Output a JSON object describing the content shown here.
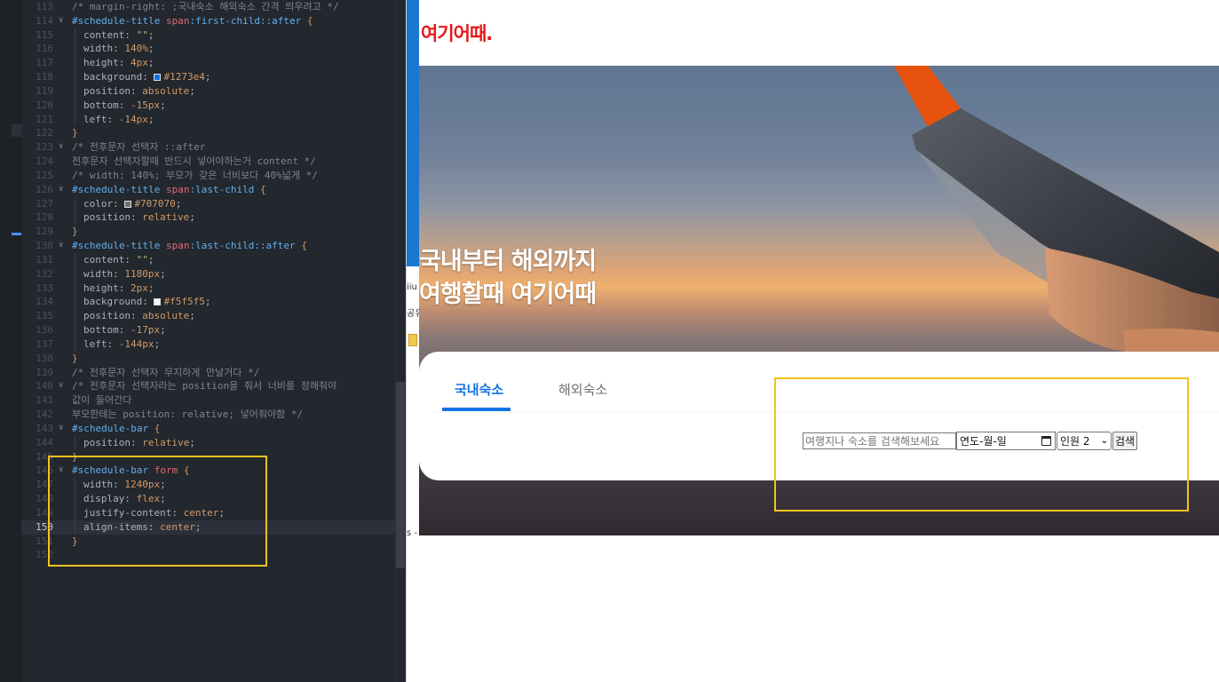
{
  "editor": {
    "lines": [
      {
        "n": "113",
        "fold": "",
        "indent": 0,
        "parts": [
          [
            "c-com",
            "/* margin-right: ;국내숙소 해외숙소 간격 띄우려고 */"
          ]
        ]
      },
      {
        "n": "114",
        "fold": "v",
        "indent": 0,
        "parts": [
          [
            "c-sel",
            "#schedule-title "
          ],
          [
            "c-tag",
            "span"
          ],
          [
            "c-sel",
            ":first-child::after "
          ],
          [
            "c-brc",
            "{"
          ]
        ]
      },
      {
        "n": "115",
        "fold": "",
        "indent": 1,
        "parts": [
          [
            "c-pro",
            "content: "
          ],
          [
            "c-str",
            "\"\""
          ],
          [
            "c-pun",
            ";"
          ]
        ]
      },
      {
        "n": "116",
        "fold": "",
        "indent": 1,
        "parts": [
          [
            "c-pro",
            "width: "
          ],
          [
            "c-val",
            "140%"
          ],
          [
            "c-pun",
            ";"
          ]
        ]
      },
      {
        "n": "117",
        "fold": "",
        "indent": 1,
        "parts": [
          [
            "c-pro",
            "height: "
          ],
          [
            "c-val",
            "4px"
          ],
          [
            "c-pun",
            ";"
          ]
        ]
      },
      {
        "n": "118",
        "fold": "",
        "indent": 1,
        "parts": [
          [
            "c-pro",
            "background: "
          ],
          [
            "swatch",
            "#1273e4"
          ],
          [
            "c-val",
            "#1273e4"
          ],
          [
            "c-pun",
            ";"
          ]
        ]
      },
      {
        "n": "119",
        "fold": "",
        "indent": 1,
        "parts": [
          [
            "c-pro",
            "position: "
          ],
          [
            "c-val",
            "absolute"
          ],
          [
            "c-pun",
            ";"
          ]
        ]
      },
      {
        "n": "120",
        "fold": "",
        "indent": 1,
        "parts": [
          [
            "c-pro",
            "bottom: "
          ],
          [
            "c-val",
            "-15px"
          ],
          [
            "c-pun",
            ";"
          ]
        ]
      },
      {
        "n": "121",
        "fold": "",
        "indent": 1,
        "parts": [
          [
            "c-pro",
            "left: "
          ],
          [
            "c-val",
            "-14px"
          ],
          [
            "c-pun",
            ";"
          ]
        ]
      },
      {
        "n": "122",
        "fold": "",
        "indent": 0,
        "parts": [
          [
            "c-brc",
            "}"
          ]
        ]
      },
      {
        "n": "123",
        "fold": "v",
        "indent": 0,
        "parts": [
          [
            "c-com",
            "/* 전후문자 선택자 ::after"
          ]
        ]
      },
      {
        "n": "124",
        "fold": "",
        "indent": 0,
        "parts": [
          [
            "c-com",
            "전후문자 선택자할때 반드시 넣어야하는거 content */"
          ]
        ]
      },
      {
        "n": "125",
        "fold": "",
        "indent": 0,
        "parts": [
          [
            "c-com",
            "/* width: 140%; 부모가 갖은 너비보다 40%넓게 */"
          ]
        ]
      },
      {
        "n": "126",
        "fold": "v",
        "indent": 0,
        "parts": [
          [
            "c-sel",
            "#schedule-title "
          ],
          [
            "c-tag",
            "span"
          ],
          [
            "c-sel",
            ":last-child "
          ],
          [
            "c-brc",
            "{"
          ]
        ]
      },
      {
        "n": "127",
        "fold": "",
        "indent": 1,
        "parts": [
          [
            "c-pro",
            "color: "
          ],
          [
            "swatch",
            "#707070"
          ],
          [
            "c-val",
            "#707070"
          ],
          [
            "c-pun",
            ";"
          ]
        ]
      },
      {
        "n": "128",
        "fold": "",
        "indent": 1,
        "parts": [
          [
            "c-pro",
            "position: "
          ],
          [
            "c-val",
            "relative"
          ],
          [
            "c-pun",
            ";"
          ]
        ]
      },
      {
        "n": "129",
        "fold": "",
        "indent": 0,
        "parts": [
          [
            "c-brc",
            "}"
          ]
        ]
      },
      {
        "n": "130",
        "fold": "v",
        "indent": 0,
        "parts": [
          [
            "c-sel",
            "#schedule-title "
          ],
          [
            "c-tag",
            "span"
          ],
          [
            "c-sel",
            ":last-child::after "
          ],
          [
            "c-brc",
            "{"
          ]
        ]
      },
      {
        "n": "131",
        "fold": "",
        "indent": 1,
        "parts": [
          [
            "c-pro",
            "content: "
          ],
          [
            "c-str",
            "\"\""
          ],
          [
            "c-pun",
            ";"
          ]
        ]
      },
      {
        "n": "132",
        "fold": "",
        "indent": 1,
        "parts": [
          [
            "c-pro",
            "width: "
          ],
          [
            "c-val",
            "1180px"
          ],
          [
            "c-pun",
            ";"
          ]
        ]
      },
      {
        "n": "133",
        "fold": "",
        "indent": 1,
        "parts": [
          [
            "c-pro",
            "height: "
          ],
          [
            "c-val",
            "2px"
          ],
          [
            "c-pun",
            ";"
          ]
        ]
      },
      {
        "n": "134",
        "fold": "",
        "indent": 1,
        "parts": [
          [
            "c-pro",
            "background: "
          ],
          [
            "swatch",
            "#f5f5f5"
          ],
          [
            "c-val",
            "#f5f5f5"
          ],
          [
            "c-pun",
            ";"
          ]
        ]
      },
      {
        "n": "135",
        "fold": "",
        "indent": 1,
        "parts": [
          [
            "c-pro",
            "position: "
          ],
          [
            "c-val",
            "absolute"
          ],
          [
            "c-pun",
            ";"
          ]
        ]
      },
      {
        "n": "136",
        "fold": "",
        "indent": 1,
        "parts": [
          [
            "c-pro",
            "bottom: "
          ],
          [
            "c-val",
            "-17px"
          ],
          [
            "c-pun",
            ";"
          ]
        ]
      },
      {
        "n": "137",
        "fold": "",
        "indent": 1,
        "parts": [
          [
            "c-pro",
            "left: "
          ],
          [
            "c-val",
            "-144px"
          ],
          [
            "c-pun",
            ";"
          ]
        ]
      },
      {
        "n": "138",
        "fold": "",
        "indent": 0,
        "parts": [
          [
            "c-brc",
            "}"
          ]
        ]
      },
      {
        "n": "139",
        "fold": "",
        "indent": 0,
        "parts": [
          [
            "c-com",
            "/* 전후문자 선택자 무지하게 만날거다 */"
          ]
        ]
      },
      {
        "n": "140",
        "fold": "v",
        "indent": 0,
        "parts": [
          [
            "c-com",
            "/* 전후문자 선택자라는 position을 줘서 너비를 정해줘야"
          ]
        ]
      },
      {
        "n": "141",
        "fold": "",
        "indent": 0,
        "parts": [
          [
            "c-com",
            "값이 들어간다"
          ]
        ]
      },
      {
        "n": "142",
        "fold": "",
        "indent": 0,
        "parts": [
          [
            "c-com",
            "부모한테는 position: relative; 넣어줘야함 */"
          ]
        ]
      },
      {
        "n": "143",
        "fold": "v",
        "indent": 0,
        "parts": [
          [
            "c-sel",
            "#schedule-bar "
          ],
          [
            "c-brc",
            "{"
          ]
        ]
      },
      {
        "n": "144",
        "fold": "",
        "indent": 1,
        "parts": [
          [
            "c-pro",
            "position: "
          ],
          [
            "c-val",
            "relative"
          ],
          [
            "c-pun",
            ";"
          ]
        ]
      },
      {
        "n": "145",
        "fold": "",
        "indent": 0,
        "parts": [
          [
            "c-brc",
            "}"
          ]
        ]
      },
      {
        "n": "146",
        "fold": "v",
        "indent": 0,
        "parts": [
          [
            "c-sel",
            "#schedule-bar "
          ],
          [
            "c-tag",
            "form "
          ],
          [
            "c-brc",
            "{"
          ]
        ]
      },
      {
        "n": "147",
        "fold": "",
        "indent": 1,
        "parts": [
          [
            "c-pro",
            "width: "
          ],
          [
            "c-val",
            "1240px"
          ],
          [
            "c-pun",
            ";"
          ]
        ]
      },
      {
        "n": "148",
        "fold": "",
        "indent": 1,
        "parts": [
          [
            "c-pro",
            "display: "
          ],
          [
            "c-val",
            "flex"
          ],
          [
            "c-pun",
            ";"
          ]
        ]
      },
      {
        "n": "149",
        "fold": "",
        "indent": 1,
        "parts": [
          [
            "c-pro",
            "justify-content: "
          ],
          [
            "c-val",
            "center"
          ],
          [
            "c-pun",
            ";"
          ]
        ]
      },
      {
        "n": "150",
        "fold": "",
        "indent": 1,
        "parts": [
          [
            "c-pro",
            "align-items: "
          ],
          [
            "c-val",
            "center"
          ],
          [
            "c-pun",
            ";"
          ]
        ]
      },
      {
        "n": "151",
        "fold": "",
        "indent": 0,
        "parts": [
          [
            "c-brc",
            "}"
          ]
        ]
      },
      {
        "n": "152",
        "fold": "",
        "indent": 0,
        "parts": []
      }
    ],
    "current_line": "150"
  },
  "behind_window": {
    "fragments": [
      "iiu",
      "공유",
      "s -"
    ]
  },
  "page": {
    "logo": "여기어때.",
    "hero_line1": "국내부터 해외까지",
    "hero_line2": "여행할때 여기어때",
    "tab_domestic": "국내숙소",
    "tab_overseas": "해외숙소",
    "search_placeholder": "여행지나 숙소를 검색해보세요",
    "date_value": "연도-월-일",
    "guests_selected": "인원 2",
    "search_button": "검색",
    "accent_color": "#1273e4",
    "logo_color": "#e8181a"
  },
  "annotation_color": "#f6c21c"
}
